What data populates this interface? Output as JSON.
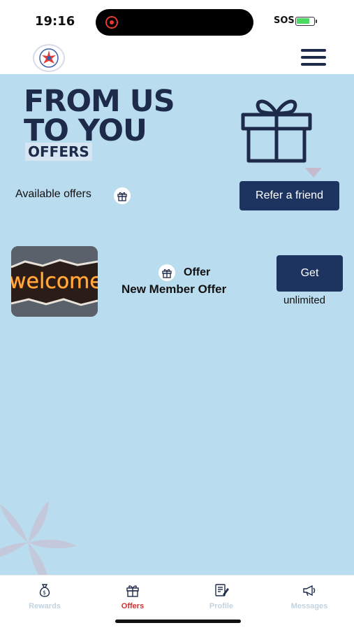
{
  "status": {
    "time": "19:16",
    "sos": "SOS"
  },
  "hero": {
    "line1": "FROM US",
    "line2": "TO YOU",
    "tag": "OFFERS"
  },
  "offers_section": {
    "available_label": "Available offers",
    "refer_button": "Refer a friend"
  },
  "offer_card": {
    "image_text": "welcome",
    "type_label": "Offer",
    "title": "New Member Offer",
    "get_button": "Get",
    "limit_text": "unlimited"
  },
  "tabs": [
    {
      "label": "Rewards",
      "icon": "money-bag-icon",
      "active": false
    },
    {
      "label": "Offers",
      "icon": "gift-icon",
      "active": true
    },
    {
      "label": "Profile",
      "icon": "profile-card-icon",
      "active": false
    },
    {
      "label": "Messages",
      "icon": "megaphone-icon",
      "active": false
    }
  ],
  "colors": {
    "background": "#b9dcee",
    "primary": "#1d3461",
    "active_tab": "#d32f2f",
    "inactive_tab": "#c3d3e0"
  }
}
